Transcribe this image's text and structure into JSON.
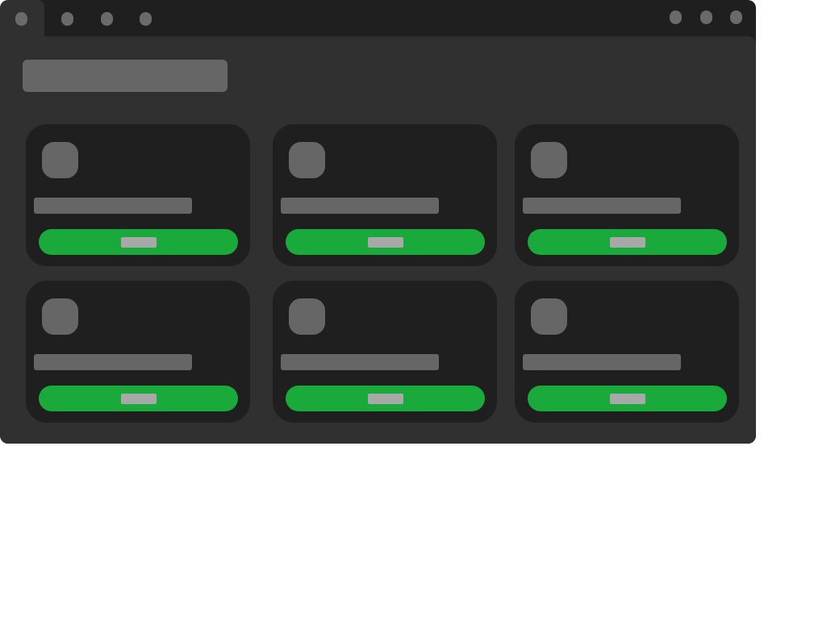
{
  "window": {
    "tabs": [
      {
        "name": "tab-1",
        "active": true
      },
      {
        "name": "tab-2",
        "active": false
      },
      {
        "name": "tab-3",
        "active": false
      },
      {
        "name": "tab-4",
        "active": false
      }
    ],
    "controls": [
      "minimize",
      "maximize",
      "close"
    ]
  },
  "cards": [
    {
      "icon": "placeholder-icon",
      "label": "",
      "button_label": ""
    },
    {
      "icon": "placeholder-icon",
      "label": "",
      "button_label": ""
    },
    {
      "icon": "placeholder-icon",
      "label": "",
      "button_label": ""
    },
    {
      "icon": "placeholder-icon",
      "label": "",
      "button_label": ""
    },
    {
      "icon": "placeholder-icon",
      "label": "",
      "button_label": ""
    },
    {
      "icon": "placeholder-icon",
      "label": "",
      "button_label": ""
    }
  ],
  "colors": {
    "window_frame": "#1f1f1f",
    "content_bg": "#303030",
    "card_bg": "#1f1f1f",
    "placeholder": "#666666",
    "button_accent": "#1aaa3b",
    "button_label_placeholder": "#a8a8a8"
  }
}
